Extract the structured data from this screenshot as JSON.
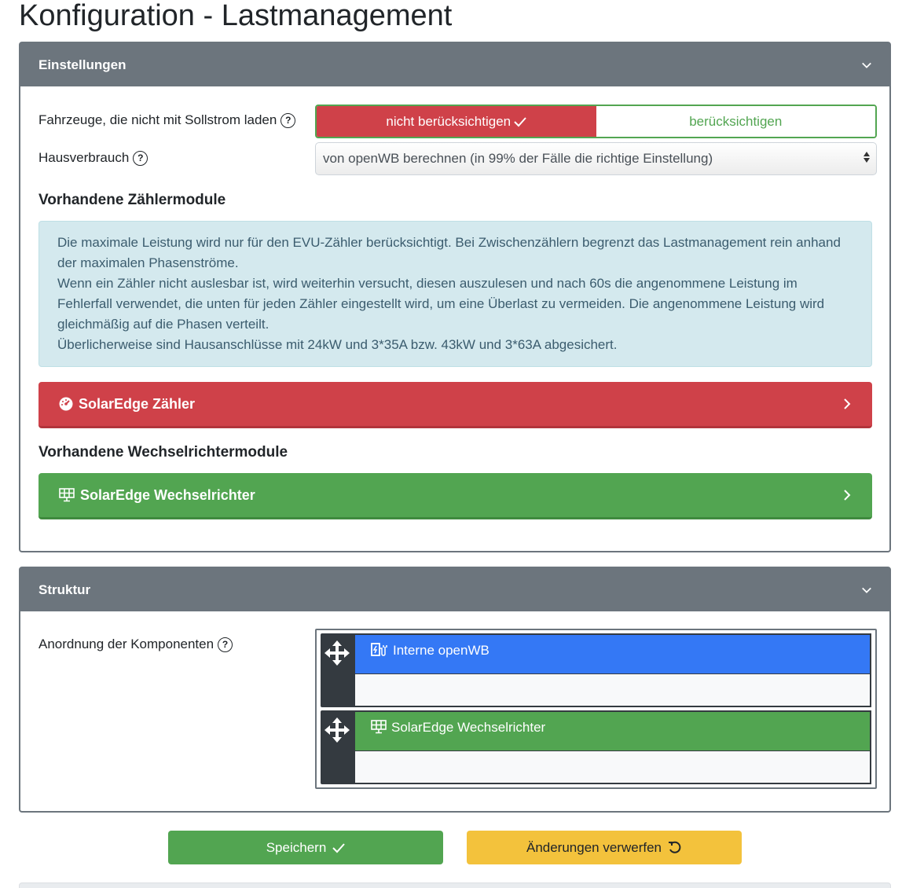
{
  "page": {
    "title": "Konfiguration - Lastmanagement"
  },
  "settings_card": {
    "title": "Einstellungen",
    "vehicles_label": "Fahrzeuge, die nicht mit Sollstrom laden",
    "vehicles_options": [
      "nicht berücksichtigen",
      "berücksichtigen"
    ],
    "vehicles_selected": "nicht berücksichtigen",
    "house_label": "Hausverbrauch",
    "house_value": "von openWB berechnen (in 99% der Fälle die richtige Einstellung)",
    "counter_heading": "Vorhandene Zählermodule",
    "info_lines": [
      "Die maximale Leistung wird nur für den EVU-Zähler berücksichtigt. Bei Zwischenzählern begrenzt das Lastmanagement rein anhand der maximalen Phasenströme.",
      "Wenn ein Zähler nicht auslesbar ist, wird weiterhin versucht, diesen auszulesen und nach 60s die angenommene Leistung im Fehlerfall verwendet, die unten für jeden Zähler eingestellt wird, um eine Überlast zu vermeiden. Die angenommene Leistung wird gleichmäßig auf die Phasen verteilt.",
      "Überlicherweise sind Hausanschlüsse mit 24kW und 3*35A bzw. 43kW und 3*63A abgesichert."
    ],
    "counter_module": {
      "label": "SolarEdge Zähler",
      "icon": "gauge-icon",
      "color": "#cf4149"
    },
    "inverter_heading": "Vorhandene Wechselrichtermodule",
    "inverter_module": {
      "label": "SolarEdge Wechselrichter",
      "icon": "solar-panel-icon",
      "color": "#52a551"
    }
  },
  "structure_card": {
    "title": "Struktur",
    "arrangement_label": "Anordnung der Komponenten",
    "components": [
      {
        "label": "Interne openWB",
        "icon": "charging-station-icon",
        "color": "#3478f5"
      },
      {
        "label": "SolarEdge Wechselrichter",
        "icon": "solar-panel-icon",
        "color": "#52a551"
      }
    ]
  },
  "actions": {
    "save_label": "Speichern",
    "discard_label": "Änderungen verwerfen"
  },
  "colors": {
    "header_gray": "#6c757d",
    "danger": "#cf4149",
    "success": "#52a551",
    "primary": "#3478f5",
    "warning": "#f3c23c",
    "info_bg": "#d4e9ee"
  }
}
